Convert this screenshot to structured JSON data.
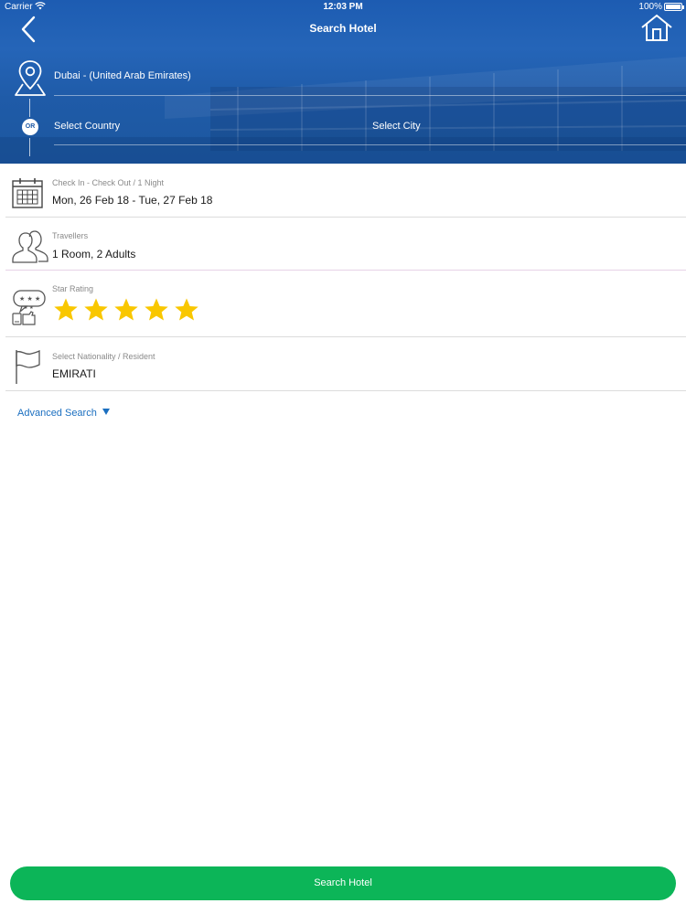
{
  "status_bar": {
    "carrier": "Carrier",
    "time": "12:03 PM",
    "battery": "100%"
  },
  "nav": {
    "title": "Search Hotel"
  },
  "destination": {
    "value": "Dubai - (United Arab Emirates)",
    "or_label": "OR",
    "country_placeholder": "Select Country",
    "city_placeholder": "Select City"
  },
  "dates": {
    "label": "Check In - Check Out / 1 Night",
    "value": "Mon, 26 Feb 18 - Tue, 27 Feb 18"
  },
  "travellers": {
    "label": "Travellers",
    "value": "1 Room, 2 Adults"
  },
  "star_rating": {
    "label": "Star Rating",
    "selected": 5,
    "max": 5,
    "color": "#f9c700"
  },
  "nationality": {
    "label": "Select Nationality / Resident",
    "value": "EMIRATI"
  },
  "advanced_search": {
    "label": "Advanced Search"
  },
  "search_button": {
    "label": "Search Hotel",
    "color": "#0cb558"
  },
  "colors": {
    "header_blue": "#1f5ba8",
    "link_blue": "#1b6fc0"
  }
}
